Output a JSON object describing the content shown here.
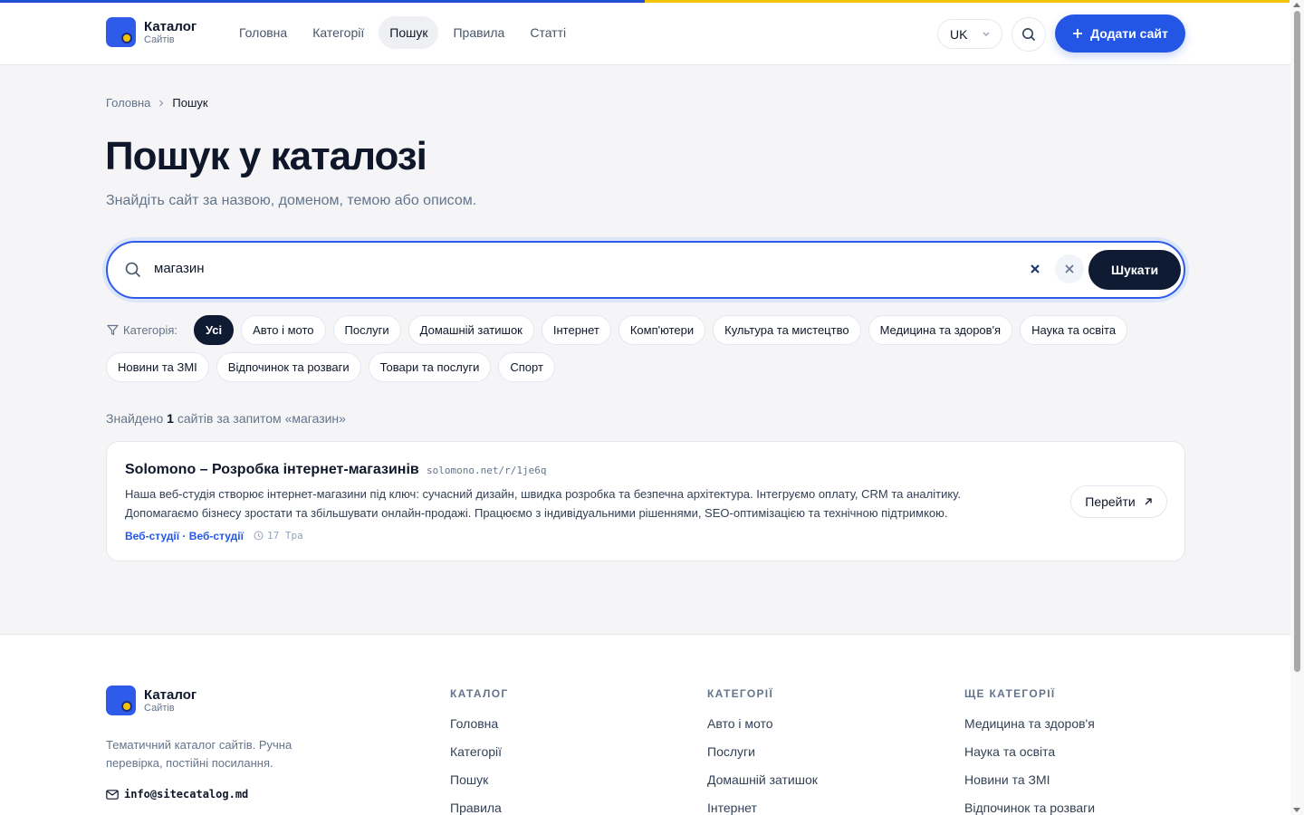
{
  "header": {
    "logo_title": "Каталог",
    "logo_sub": "Сайтів",
    "nav": [
      "Головна",
      "Категорії",
      "Пошук",
      "Правила",
      "Статті"
    ],
    "lang": "UK",
    "add_label": "Додати сайт"
  },
  "breadcrumb": {
    "home": "Головна",
    "current": "Пошук"
  },
  "page": {
    "title": "Пошук у каталозі",
    "subtitle": "Знайдіть сайт за назвою, доменом, темою або описом."
  },
  "search": {
    "value": "магазин",
    "button": "Шукати"
  },
  "filter": {
    "label": "Категорія:",
    "row1": [
      "Усі",
      "Авто і мото",
      "Послуги",
      "Домашній затишок",
      "Інтернет",
      "Комп'ютери",
      "Культура та мистецтво",
      "Медицина та здоров'я",
      "Наука та освіта"
    ],
    "row2": [
      "Новини та ЗМІ",
      "Відпочинок та розваги",
      "Товари та послуги",
      "Спорт"
    ]
  },
  "results": {
    "prefix": "Знайдено",
    "count": "1",
    "suffix": "сайтів за запитом «магазин»"
  },
  "card": {
    "title": "Solomono – Розробка інтернет-магазинів",
    "url": "solomono.net/r/1je6q",
    "desc1": "Наша веб-студія створює інтернет-магазини під ключ: сучасний дизайн, швидка розробка та безпечна архітектура. Інтегруємо оплату, CRM та аналітику.",
    "desc2": "Допомагаємо бізнесу зростати та збільшувати онлайн-продажі. Працюємо з індивідуальними рішеннями, SEO-оптимізацією та технічною підтримкою.",
    "tags": "Веб-студії · Веб-студії",
    "date": "17 Тра",
    "go": "Перейти"
  },
  "footer": {
    "logo_title": "Каталог",
    "logo_sub": "Сайтів",
    "desc": "Тематичний каталог сайтів. Ручна перевірка, постійні посилання.",
    "email": "info@sitecatalog.md",
    "col1": {
      "title": "КАТАЛОГ",
      "links": [
        "Головна",
        "Категорії",
        "Пошук",
        "Правила"
      ]
    },
    "col2": {
      "title": "КАТЕГОРІЇ",
      "links": [
        "Авто і мото",
        "Послуги",
        "Домашній затишок",
        "Інтернет"
      ]
    },
    "col3": {
      "title": "ЩЕ КАТЕГОРІЇ",
      "links": [
        "Медицина та здоров'я",
        "Наука та освіта",
        "Новини та ЗМІ",
        "Відпочинок та розваги"
      ]
    }
  },
  "colors": {
    "accent": "#2456e6",
    "dark": "#0f1a33",
    "yellow": "#f5c400"
  }
}
